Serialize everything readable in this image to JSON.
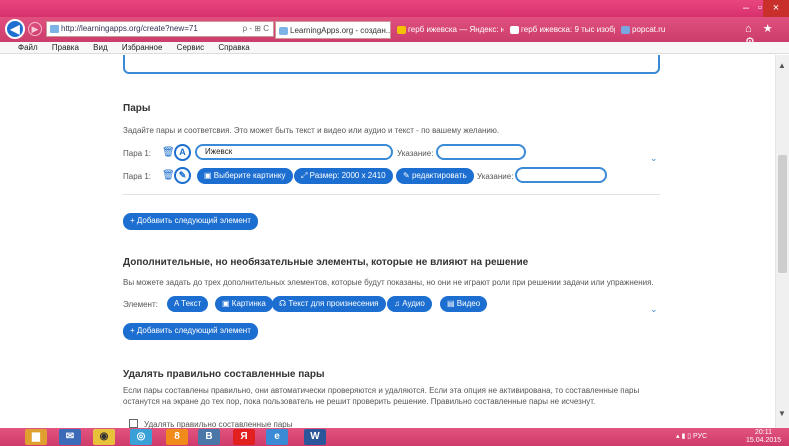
{
  "browser": {
    "address": "http://learningapps.org/create?new=71",
    "address_tools": "ρ - ⊞ C",
    "tabs": [
      {
        "label": "LearningApps.org - создан...",
        "close": "×",
        "icon_color": "#7db4e8"
      },
      {
        "label": "герб ижевска — Яндекс: на...",
        "icon_color": "#f2c200"
      },
      {
        "label": "герб ижевска: 9 тыс изобра...",
        "icon_color": "#ffffff"
      },
      {
        "label": "popcat.ru",
        "icon_color": "#7aa7e0"
      }
    ],
    "nav_icons": "⌂ ★ ⚙",
    "window_buttons": {
      "minimize": "–",
      "maximize": "▫",
      "close": "×"
    },
    "menu": [
      "Файл",
      "Правка",
      "Вид",
      "Избранное",
      "Сервис",
      "Справка"
    ]
  },
  "pairs": {
    "title": "Пары",
    "description": "Задайте пары и соответсвия. Это может быть текст и видео или аудио и текст - по вашему желанию.",
    "row1": {
      "label": "Пара 1:",
      "type_icon": "A",
      "value": "Ижевск",
      "hint_label": "Указание:",
      "hint_value": ""
    },
    "row2": {
      "label": "Пара 1:",
      "type_icon": "✎",
      "choose_image": "Выберите картинку",
      "size": "Размер: 2000 x 2410",
      "edit": "редактировать",
      "hint_label": "Указание:",
      "hint_value": ""
    },
    "add_button": "+ Добавить следующий элемент"
  },
  "extras": {
    "title": "Дополнительные, но необязательные элементы, которые не влияют на решение",
    "description": "Вы можете задать до трех дополнительных элементов, которые будут показаны, но они не играют роли при решении задачи или упражнения.",
    "element_label": "Элемент:",
    "buttons": [
      "Текст",
      "Картинка",
      "Текст для произнесения",
      "Аудио",
      "Видео"
    ],
    "add_button": "+ Добавить следующий элемент"
  },
  "delete_pairs": {
    "title": "Удалять правильно составленные пары",
    "description_line1": "Если пары составлены правильно, они автоматически проверяются и удаляются. Если эта опция не активирована, то составленные пары",
    "description_line2": "останутся на экране до тех пор, пока пользователь не решит проверить решение. Правильно составленные пары не исчезнут.",
    "checkbox_label": "Удалять правильно составленные пары",
    "checked": false
  },
  "taskbar": {
    "apps": [
      {
        "name": "explorer",
        "glyph": "▆",
        "color": "#e0a030"
      },
      {
        "name": "mail",
        "glyph": "✉",
        "color": "#3a6ab8"
      },
      {
        "name": "chrome",
        "glyph": "◉",
        "color": "#e8c23a"
      },
      {
        "name": "browser",
        "glyph": "◎",
        "color": "#3aa0d8"
      },
      {
        "name": "ok",
        "glyph": "8",
        "color": "#f08a1a"
      },
      {
        "name": "vk",
        "glyph": "B",
        "color": "#4a76a8"
      },
      {
        "name": "yandex",
        "glyph": "Я",
        "color": "#e32020"
      },
      {
        "name": "ie",
        "glyph": "e",
        "color": "#3a8ad6"
      },
      {
        "name": "word",
        "glyph": "W",
        "color": "#2b579a"
      }
    ],
    "tray": "▴  ▮  ▯  РУС",
    "time": "20:11",
    "date": "15.04.2015"
  }
}
